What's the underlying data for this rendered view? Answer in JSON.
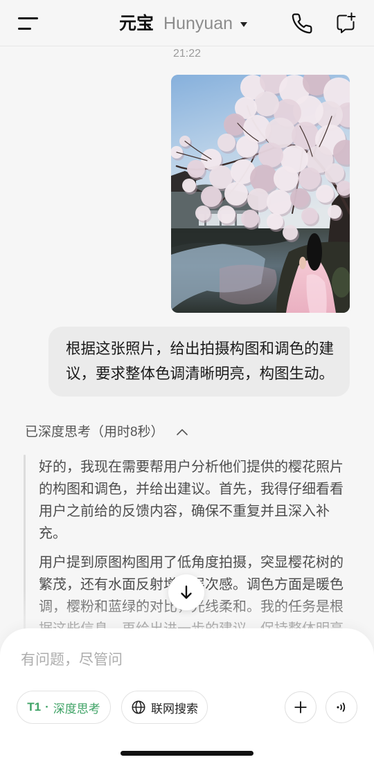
{
  "header": {
    "menu_icon": "menu-icon",
    "title": "元宝",
    "model": "Hunyuan",
    "model_dropdown_icon": "caret-down-icon",
    "call_icon": "phone-icon",
    "new_chat_icon": "new-chat-icon"
  },
  "chat": {
    "timestamp": "21:22",
    "user_message": "根据这张照片，给出拍摄构图和调色的建议，要求整体色调清晰明亮，构图生动。",
    "thinking": {
      "status": "已深度思考（用时8秒）",
      "expanded": true,
      "toggle_icon": "chevron-up-icon",
      "paragraphs": [
        "好的，我现在需要帮用户分析他们提供的樱花照片的构图和调色，并给出建议。首先，我得仔细看看用户之前给的反馈内容，确保不重复并且深入补充。",
        "用户提到原图构图用了低角度拍摄，突显樱花树的繁茂，还有水面反射增加层次感。调色方面是暖色调，樱粉和蓝绿的对比，光线柔和。我的任务是根据这些信息，再给出进一步的建议，保持整体明亮"
      ]
    },
    "scroll_to_bottom_icon": "arrow-down-icon"
  },
  "composer": {
    "placeholder": "有问题，尽管问",
    "value": "",
    "deep_think": {
      "model": "T1",
      "separator": "·",
      "label": "深度思考",
      "active": true
    },
    "web_search": {
      "icon": "globe-icon",
      "label": "联网搜索",
      "active": false
    },
    "add_icon": "plus-icon",
    "voice_icon": "voice-icon"
  },
  "colors": {
    "accent": "#3fa366",
    "background": "#f6f6f6",
    "user_bubble": "#ebebeb",
    "panel": "#ffffff"
  }
}
